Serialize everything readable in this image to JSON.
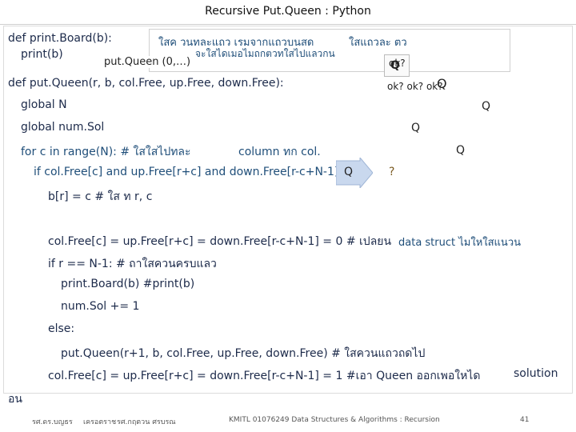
{
  "slide": {
    "title": "Recursive Put.Queen : Python",
    "page_number": "41"
  },
  "code": {
    "line1": "def print.Board(b):",
    "line2": "print(b)",
    "line2b": "put.Queen (0,…)",
    "line3": "def put.Queen(r, b, col.Free, up.Free, down.Free):",
    "line4": "global N",
    "line5": "global num.Sol",
    "line6a": "for c in range(N): # ใสใสไปทละ",
    "line6b": "column ทก  col.",
    "line7": "if col.Free[c] and up.Free[r+c] and down.Free[r-c+N-1]",
    "line7q": "Q",
    "line7s": "?",
    "line8": "b[r] = c  # ใส  ท      r, c",
    "line9": "col.Free[c] = up.Free[r+c] = down.Free[r-c+N-1] = 0 # เปลยน",
    "line9note": "data struct ไมใหใสแนวน",
    "line10": "if r == N-1:  # ถาใสควนครบแลว",
    "line11": "print.Board(b) #print(b)",
    "line12": "num.Sol += 1",
    "line13": "else:",
    "line14": "put.Queen(r+1, b, col.Free, up.Free, down.Free) # ใสควนแถวถดไป",
    "line15": "col.Free[c] = up.Free[r+c] = down.Free[r-c+N-1] = 1 #เอา Queen ออกเพอใหได",
    "line15b": "solution",
    "line16": "อน"
  },
  "annotations": {
    "a1": "ใสค  วนทละแถว     เรมจากแถวบนสด",
    "a2": "จะใสไดเมอไมถกตวทใสไปแลวกน",
    "a3": "ใสแถวละ  ตว",
    "ok1": "ok?",
    "ok2": "ok? ok? ok?",
    "q1": "Q",
    "q2": "Q",
    "q3": "Q",
    "q4": "Q",
    "q5": "Q"
  },
  "footer": {
    "left1": "รศ.ดร.บญธร",
    "left2": "เครอตราช",
    "left3": "รศ.กฤตวน  ศรบรณ",
    "center": "KMITL  01076249 Data Structures & Algorithms : Recursion"
  }
}
